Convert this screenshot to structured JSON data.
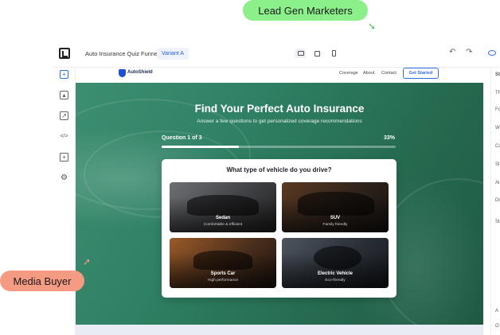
{
  "tags": {
    "lead": "Lead Gen Marketers",
    "media": "Media Buyer"
  },
  "editor": {
    "project_name": "Auto Insurance Quiz Funnel",
    "variant": "Variant A",
    "devices": [
      "desktop-icon",
      "tablet-icon",
      "mobile-icon"
    ],
    "undo_icon": "↶",
    "redo_icon": "↷",
    "left_tools": [
      "add-icon",
      "image-icon",
      "external-link-icon",
      "code-icon",
      "folder-icon",
      "settings-icon"
    ],
    "right_panel_letters": [
      "St",
      "Th",
      "Fo",
      "W",
      "Co",
      "Sl",
      "Al",
      "Di",
      "St",
      "A",
      "O"
    ]
  },
  "site": {
    "brand": "AutoShield",
    "nav": [
      "Coverage",
      "About",
      "Contact"
    ],
    "cta": "Get Started",
    "title": "Find Your Perfect Auto Insurance",
    "subtitle": "Answer a few questions to get personalized coverage recommendations",
    "progress_label": "Question 1 of 3",
    "progress_pct": "33%",
    "progress_value": 0.33,
    "question": "What type of vehicle do you drive?",
    "options": [
      {
        "title": "Sedan",
        "desc": "Comfortable & efficient"
      },
      {
        "title": "SUV",
        "desc": "Family friendly"
      },
      {
        "title": "Sports Car",
        "desc": "High performance"
      },
      {
        "title": "Electric Vehicle",
        "desc": "Eco-friendly"
      }
    ]
  },
  "colors": {
    "accent": "#2f6fe0",
    "hero": "#2f8064",
    "lead_tag": "#8cf08a",
    "media_tag": "#f59b84"
  }
}
